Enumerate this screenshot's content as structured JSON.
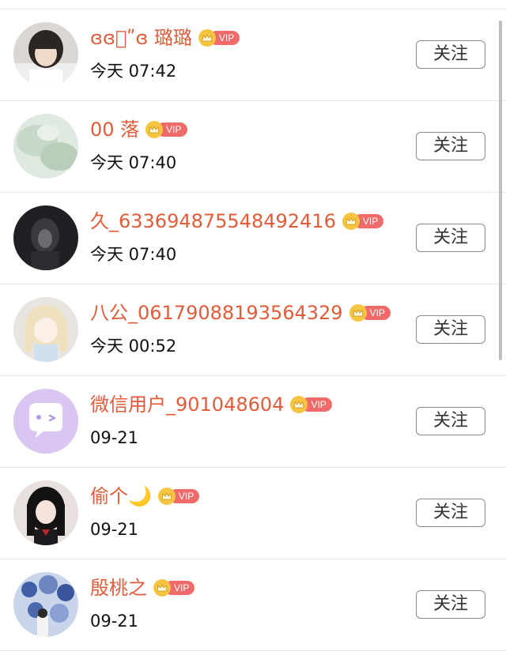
{
  "list": [
    {
      "name": "ɞɞ⃞ʺɞ 璐璐",
      "time": "今天 07:42",
      "vip": "VIP",
      "follow": "关注",
      "avatar": "photo-girl-glasses"
    },
    {
      "name": "00 落",
      "time": "今天 07:40",
      "vip": "VIP",
      "follow": "关注",
      "avatar": "photo-misty-green"
    },
    {
      "name": "久_633694875548492416",
      "time": "今天 07:40",
      "vip": "VIP",
      "follow": "关注",
      "avatar": "photo-dark-girl"
    },
    {
      "name": "八公_06179088193564329",
      "time": "今天 00:52",
      "vip": "VIP",
      "follow": "关注",
      "avatar": "photo-doll-blonde"
    },
    {
      "name": "微信用户_901048604",
      "time": "09-21",
      "vip": "VIP",
      "follow": "关注",
      "avatar": "default-chat-face"
    },
    {
      "name": "偷个🌙",
      "time": "09-21",
      "vip": "VIP",
      "follow": "关注",
      "avatar": "photo-girl-black-hair"
    },
    {
      "name": "殷桃之",
      "time": "09-21",
      "vip": "VIP",
      "follow": "关注",
      "avatar": "photo-blue-flowers"
    }
  ],
  "colors": {
    "name": "#e25c3a",
    "vip_tag": "#f06a6a",
    "crown": "#f5c542"
  }
}
